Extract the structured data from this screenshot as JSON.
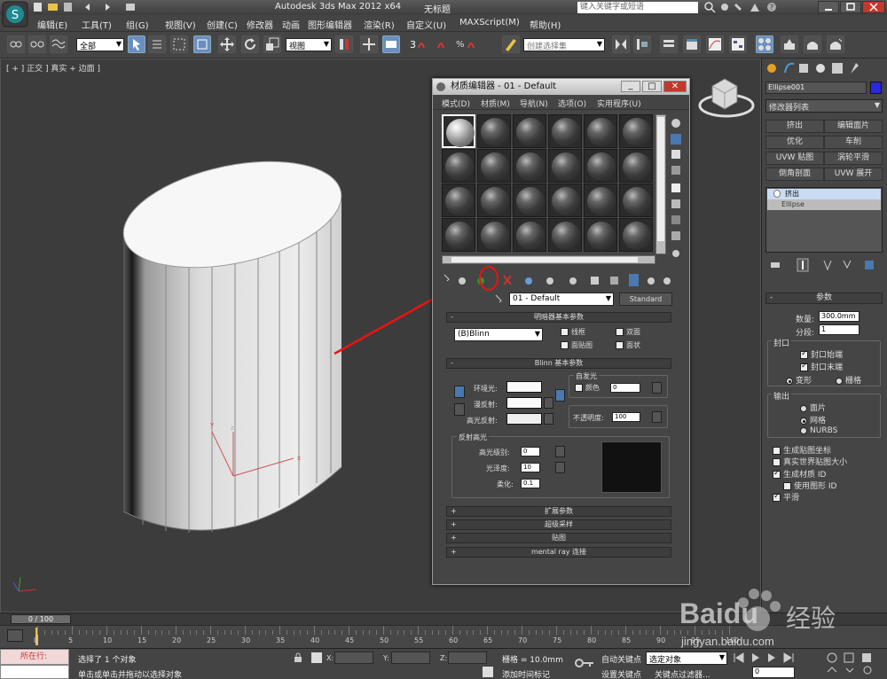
{
  "title_bar": {
    "app_title": "Autodesk 3ds Max  2012 x64",
    "doc_title": "无标题",
    "search_placeholder": "键入关键字或短语"
  },
  "menu": [
    "编辑(E)",
    "工具(T)",
    "组(G)",
    "视图(V)",
    "创建(C)",
    "修改器",
    "动画",
    "图形编辑器",
    "渲染(R)",
    "自定义(U)",
    "MAXScript(M)",
    "帮助(H)"
  ],
  "toolbar": {
    "selection_filter": "全部",
    "ref_coord": "视图",
    "snap_value": "3",
    "named_selection": "创建选择集"
  },
  "viewport": {
    "label": "[ + ] 正交 ] 真实 + 边面 ]"
  },
  "material_editor": {
    "title": "材质编辑器 - 01 - Default",
    "menu": [
      "模式(D)",
      "材质(M)",
      "导航(N)",
      "选项(O)",
      "实用程序(U)"
    ],
    "material_name": "01 - Default",
    "material_type": "Standard",
    "shader_rollout": "明暗器基本参数",
    "shader": "(B)Blinn",
    "wire": "线框",
    "two_sided": "双面",
    "face_map": "面贴图",
    "faceted": "面状",
    "blinn_rollout": "Blinn 基本参数",
    "self_illum": "自发光",
    "self_illum_color": "颜色",
    "self_illum_value": "0",
    "ambient": "环境光:",
    "diffuse": "漫反射:",
    "specular": "高光反射:",
    "opacity": "不透明度:",
    "opacity_value": "100",
    "specular_highlights": "反射高光",
    "spec_level": "高光级别:",
    "spec_level_value": "0",
    "glossiness": "光泽度:",
    "glossiness_value": "10",
    "soften": "柔化:",
    "soften_value": "0.1",
    "extended": "扩展参数",
    "supersampling": "超级采样",
    "maps": "贴图",
    "mental_ray": "mental ray 连接"
  },
  "command_panel": {
    "object_name": "Ellipse001",
    "modifier_list": "修改器列表",
    "mod_buttons": [
      "挤出",
      "编辑面片",
      "优化",
      "车削",
      "UVW 贴图",
      "涡轮平滑",
      "倒角剖面",
      "UVW 展开"
    ],
    "stack": [
      "挤出",
      "Ellipse"
    ],
    "params_title": "参数",
    "amount_label": "数量:",
    "amount_value": "300.0mm",
    "segments_label": "分段:",
    "segments_value": "1",
    "capping": "封口",
    "cap_start": "封口始端",
    "cap_end": "封口末端",
    "morph": "变形",
    "grid": "栅格",
    "output": "输出",
    "patch": "面片",
    "mesh": "网格",
    "nurbs": "NURBS",
    "gen_map_coords": "生成贴图坐标",
    "real_world": "真实世界贴图大小",
    "gen_mat_ids": "生成材质 ID",
    "use_shape_ids": "使用图形 ID",
    "smooth": "平滑"
  },
  "timeline": {
    "frame": "0 / 100",
    "ticks": [
      "0",
      "5",
      "10",
      "15",
      "20",
      "25",
      "30",
      "35",
      "40",
      "45",
      "50",
      "55",
      "60",
      "65",
      "70",
      "75",
      "80",
      "85",
      "90",
      "95",
      "100"
    ]
  },
  "status": {
    "running": "所在行:",
    "selected": "选择了 1 个对象",
    "prompt": "单击或单击并拖动以选择对象",
    "x_label": "X:",
    "y_label": "Y:",
    "z_label": "Z:",
    "grid": "栅格 = 10.0mm",
    "add_time_tag": "添加时间标记",
    "auto_key": "自动关键点",
    "selected_dropdown": "选定对象",
    "set_key": "设置关键点",
    "key_filters": "关键点过滤器...",
    "frame_value": "0"
  },
  "watermark": {
    "brand": "Baidu",
    "brand2": "经验",
    "url": "jingyan.baidu.com"
  }
}
